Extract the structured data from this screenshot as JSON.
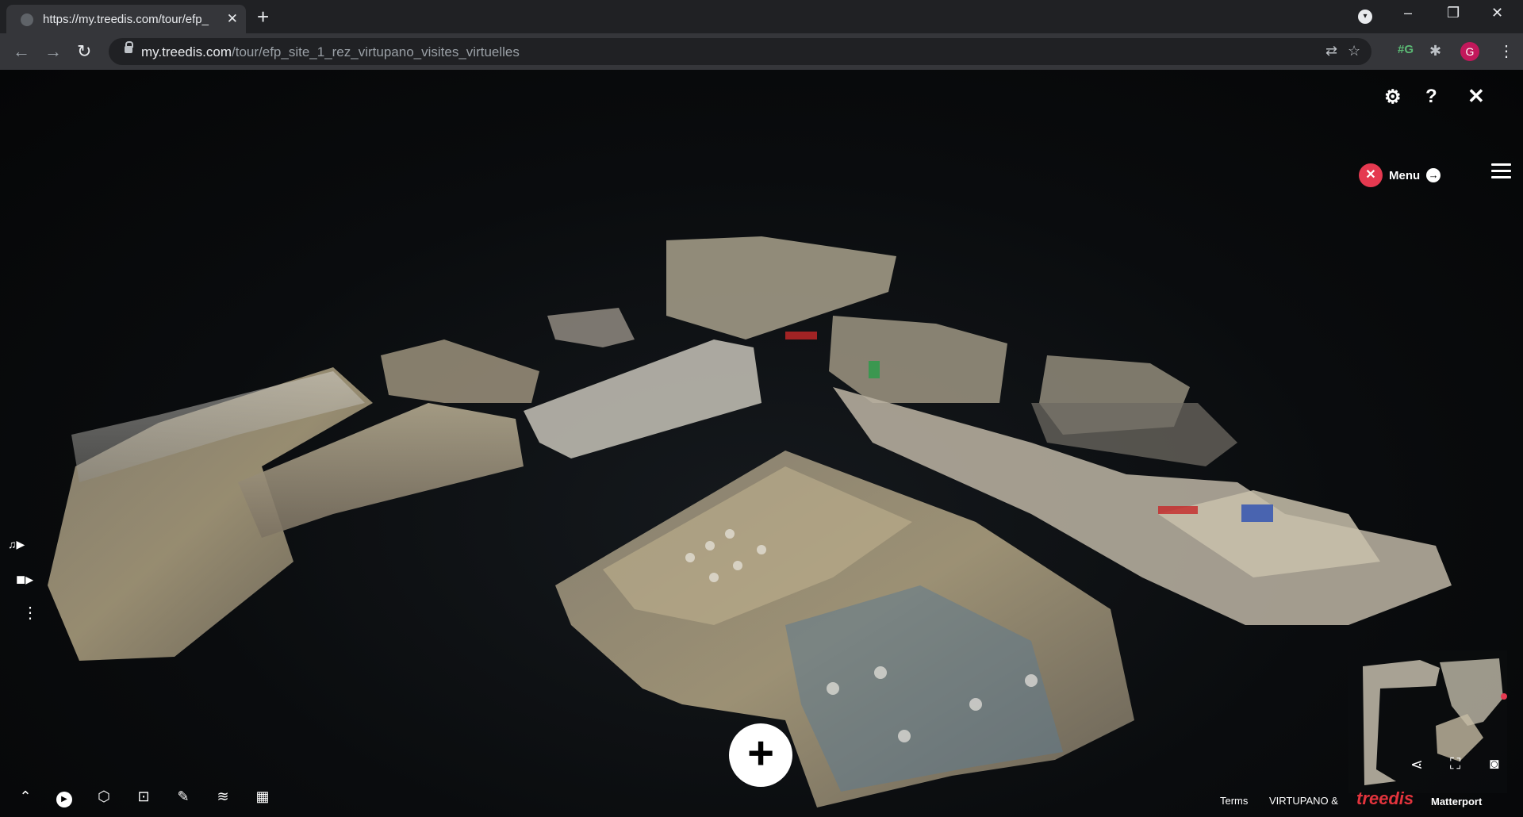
{
  "browser": {
    "tab_title": "https://my.treedis.com/tour/efp_",
    "tab_close": "✕",
    "new_tab": "+",
    "url_host": "my.treedis.com",
    "url_path": "/tour/efp_site_1_rez_virtupano_visites_virtuelles",
    "profile_initial": "G",
    "ext_text": "#G",
    "window_minimize": "–",
    "window_restore": "❐",
    "window_close": "✕"
  },
  "viewer": {
    "menu_label": "Menu",
    "footer": {
      "terms": "Terms",
      "virtupano": "VIRTUPANO &",
      "treedis": "treedis",
      "matterport": "Matterport"
    },
    "icons": {
      "settings": "gear-icon",
      "help": "question-icon",
      "close": "close-icon",
      "menu_close": "close-circle-icon",
      "menu_arrow": "arrow-right-circle-icon",
      "hamburger": "hamburger-icon",
      "music_play": "music-play-icon",
      "video": "video-camera-icon",
      "more": "vertical-dots-icon",
      "collapse": "chevron-up-icon",
      "tour_play": "play-circle-icon",
      "dollhouse": "dollhouse-icon",
      "floorplan": "floorplan-icon",
      "measure": "ruler-icon",
      "floors": "layers-icon",
      "map": "map-icon",
      "add": "plus-icon",
      "share": "share-icon",
      "fullscreen": "fullscreen-icon",
      "vr": "vr-headset-icon"
    }
  },
  "colors": {
    "chrome_dark": "#202124",
    "chrome_toolbar": "#35363a",
    "accent_red": "#e53950",
    "treedis_red": "#e3343d",
    "avatar_pink": "#c2185b"
  }
}
